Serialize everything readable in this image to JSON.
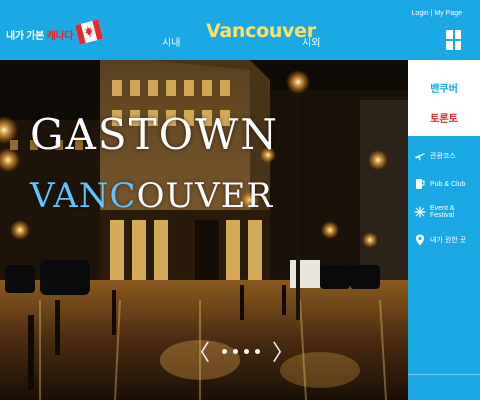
{
  "header": {
    "logo": {
      "part1": "내가 가본 ",
      "part2": "캐나다",
      "flag_icon": "canada-flag-icon"
    },
    "nav": {
      "left": "시내",
      "center": "Vancouver",
      "right": "시외"
    },
    "toplinks": "Login | My Page",
    "menu_icon": "grid-menu-icon",
    "colors": {
      "bar": "#1aa9e5",
      "center_title": "#ffe066",
      "logo_red": "#e32b2b"
    }
  },
  "hero": {
    "title_line1": "GASTOWN",
    "title_line2_accent": "VANC",
    "title_line2_rest": "OUVER",
    "prev_arrow": "〈",
    "next_arrow": "〉",
    "dots": [
      1,
      2,
      3,
      4
    ]
  },
  "sidebar": {
    "city1": "밴쿠버",
    "city2": "토론토",
    "items": [
      {
        "label": "관광코스",
        "icon": "airplane-icon"
      },
      {
        "label": "Pub & Club",
        "icon": "drink-icon"
      },
      {
        "label": "Event & Festival",
        "icon": "sparkle-icon"
      },
      {
        "label": "내가 원한 곳",
        "icon": "map-pin-icon"
      }
    ]
  }
}
